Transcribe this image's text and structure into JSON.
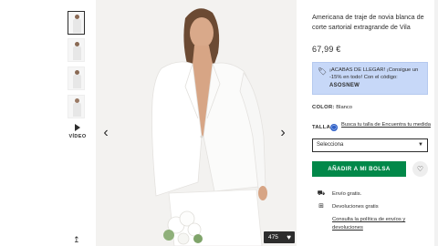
{
  "thumbnails": [
    {
      "name": "thumb-1",
      "active": true
    },
    {
      "name": "thumb-2",
      "active": false
    },
    {
      "name": "thumb-3",
      "active": false
    },
    {
      "name": "thumb-4",
      "active": false
    }
  ],
  "video": {
    "label": "VÍDEO",
    "icon": "play-icon"
  },
  "gallery": {
    "prev_icon": "chevron-left-icon",
    "next_icon": "chevron-right-icon",
    "likes_count": "475",
    "likes_icon": "heart-icon"
  },
  "product": {
    "title": "Americana de traje de novia blanca de corte sartorial extragrande de Vila",
    "price": "67,99 €"
  },
  "promo": {
    "icon": "tag-icon",
    "text": "¡ACABAS DE LLEGAR! ¡Consigue un -15% en todo! Con el código:",
    "code": "ASOSNEW",
    "color": "#c7d8f8"
  },
  "color": {
    "label": "COLOR:",
    "value": "Blanco"
  },
  "size": {
    "label": "TALLA:",
    "ruler_icon": "ruler-icon",
    "guide_link": "Busca tu talla de Encuentra tu medida",
    "select_placeholder": "Selecciona"
  },
  "actions": {
    "add_to_bag": "AÑADIR A MI BOLSA",
    "add_color": "#018849",
    "wishlist_icon": "heart-outline-icon"
  },
  "shipping": {
    "free_shipping": "Envío gratis.",
    "free_returns": "Devoluciones gratis",
    "policy_link": "Consulta la política de envíos y devoluciones"
  }
}
